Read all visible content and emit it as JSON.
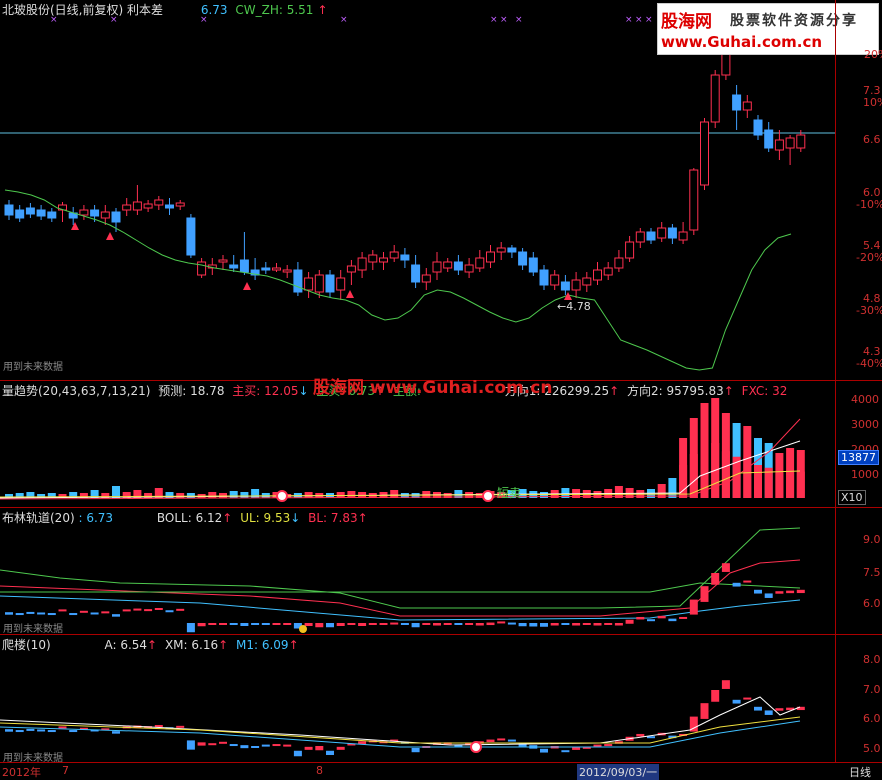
{
  "price_panel": {
    "title": "北玻股份(日线,前复权) 利本差",
    "value1": "6.73",
    "cw_label": "CW_ZH: 5.51",
    "cw_arrow": "↑",
    "low_marker": "4.78",
    "watermark": "用到未来数据",
    "price_ticks": [
      "7.3",
      "6.6",
      "6.0",
      "5.4",
      "4.8",
      "4.3"
    ],
    "pct_ticks": [
      "10%",
      "-10%",
      "-20%",
      "-30%",
      "-40%"
    ],
    "top_tick": "20%"
  },
  "volume_panel": {
    "title": "量趋势(20,43,63,7,13,21)",
    "predict": "预测: 18.78",
    "zhumai": "主买: 12.05",
    "zhumai_arrow": "↓",
    "zhumai2": "主买: 6.73",
    "zhumai2_arrow": "↑",
    "zhue": "主额: ",
    "dir1": "方向1: 226299.25",
    "dir1_arrow": "↑",
    "dir2": "方向2: 95795.83",
    "dir2_arrow": "↑",
    "fxc": "FXC: 32",
    "ticks": [
      "4000",
      "3000",
      "2000",
      "1000"
    ],
    "last_value": "13877",
    "multiplier": "X10",
    "short_sell_label": "短卖"
  },
  "boll_panel": {
    "title": "布林轨道(20)",
    "value": ": 6.73",
    "boll": "BOLL: 6.12",
    "boll_arrow": "↑",
    "ul": "UL: 9.53",
    "ul_arrow": "↓",
    "bl": "BL: 7.83",
    "bl_arrow": "↑",
    "ticks": [
      "9.0",
      "7.5",
      "6.0"
    ],
    "watermark": "用到未来数据"
  },
  "climb_panel": {
    "title": "爬楼(10)",
    "a": "A: 6.54",
    "a_arrow": "↑",
    "xm": "XM: 6.16",
    "xm_arrow": "↑",
    "m1": "M1: 6.09",
    "m1_arrow": "↑",
    "ticks": [
      "8.0",
      "7.0",
      "6.0",
      "5.0"
    ],
    "watermark": "用到未来数据"
  },
  "time_axis": {
    "year": "2012年",
    "month7": "7",
    "month8": "8",
    "cursor_date": "2012/09/03/一",
    "period": "日线"
  },
  "logo": {
    "name": "股海网",
    "slogan": "股票软件资源分享",
    "url": "www.Guhai.com.cn"
  },
  "overlay_watermark": "股海网 www.Guhai.com.cn",
  "colors": {
    "up": "#ff3050",
    "down": "#40a0ff",
    "axis": "#aa0000",
    "ma_green": "#4ec84e",
    "hline": "#60c0e0"
  }
}
